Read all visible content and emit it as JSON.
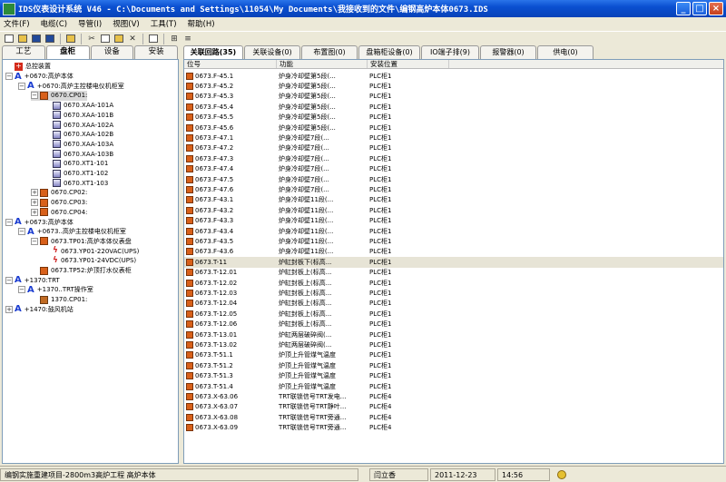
{
  "window": {
    "title": "IDS仪表设计系统 V46 - C:\\Documents and Settings\\11054\\My Documents\\我接收到的文件\\编钢高炉本体0673.IDS",
    "buttons": [
      "_",
      "□",
      "×"
    ]
  },
  "menu": [
    "文件(F)",
    "电缆(C)",
    "导管(I)",
    "视图(V)",
    "工具(T)",
    "帮助(H)"
  ],
  "left_tabs": [
    {
      "label": "工艺",
      "active": false
    },
    {
      "label": "盘柜",
      "active": true
    },
    {
      "label": "设备",
      "active": false
    },
    {
      "label": "安装",
      "active": false
    }
  ],
  "tree": [
    {
      "level": 0,
      "icon": "root",
      "expander": "",
      "label": "总控装置",
      "selected": false
    },
    {
      "level": 0,
      "icon": "area",
      "expander": "−",
      "label": "+0670:高炉本体",
      "selected": false
    },
    {
      "level": 1,
      "icon": "area",
      "expander": "−",
      "label": "+0670:高炉主控楼电仪机柜室",
      "selected": false
    },
    {
      "level": 2,
      "icon": "cab",
      "expander": "−",
      "label": "0670.CP01:",
      "selected": true
    },
    {
      "level": 3,
      "icon": "inst",
      "expander": "",
      "label": "0670.XAA-101A",
      "selected": false
    },
    {
      "level": 3,
      "icon": "inst",
      "expander": "",
      "label": "0670.XAA-101B",
      "selected": false
    },
    {
      "level": 3,
      "icon": "inst",
      "expander": "",
      "label": "0670.XAA-102A",
      "selected": false
    },
    {
      "level": 3,
      "icon": "inst",
      "expander": "",
      "label": "0670.XAA-102B",
      "selected": false
    },
    {
      "level": 3,
      "icon": "inst",
      "expander": "",
      "label": "0670.XAA-103A",
      "selected": false
    },
    {
      "level": 3,
      "icon": "inst",
      "expander": "",
      "label": "0670.XAA-103B",
      "selected": false
    },
    {
      "level": 3,
      "icon": "inst",
      "expander": "",
      "label": "0670.XT1-101",
      "selected": false
    },
    {
      "level": 3,
      "icon": "inst",
      "expander": "",
      "label": "0670.XT1-102",
      "selected": false
    },
    {
      "level": 3,
      "icon": "inst",
      "expander": "",
      "label": "0670.XT1-103",
      "selected": false
    },
    {
      "level": 2,
      "icon": "cab",
      "expander": "+",
      "label": "0670.CP02:",
      "selected": false
    },
    {
      "level": 2,
      "icon": "cab",
      "expander": "+",
      "label": "0670.CP03:",
      "selected": false
    },
    {
      "level": 2,
      "icon": "cab",
      "expander": "+",
      "label": "0670.CP04:",
      "selected": false
    },
    {
      "level": 0,
      "icon": "area",
      "expander": "−",
      "label": "+0673:高炉本体",
      "selected": false
    },
    {
      "level": 1,
      "icon": "area",
      "expander": "−",
      "label": "+0673..高炉主控楼电仪机柜室",
      "selected": false
    },
    {
      "level": 2,
      "icon": "cab",
      "expander": "−",
      "label": "0673.TP01:高炉本体仪表盘",
      "selected": false
    },
    {
      "level": 3,
      "icon": "pwr",
      "expander": "",
      "label": "0673.YP01-220VAC(UPS)",
      "selected": false
    },
    {
      "level": 3,
      "icon": "pwr",
      "expander": "",
      "label": "0673.YP01-24VDC(UPS)",
      "selected": false
    },
    {
      "level": 2,
      "icon": "cab",
      "expander": "",
      "label": "0673.TP52:炉顶打水仪表柜",
      "selected": false
    },
    {
      "level": 0,
      "icon": "area",
      "expander": "−",
      "label": "+1370:TRT",
      "selected": false
    },
    {
      "level": 1,
      "icon": "area",
      "expander": "−",
      "label": "+1370..TRT操作室",
      "selected": false
    },
    {
      "level": 2,
      "icon": "room",
      "expander": "",
      "label": "1370.CP01:",
      "selected": false
    },
    {
      "level": 0,
      "icon": "area",
      "expander": "+",
      "label": "+1470:鼓风机站",
      "selected": false
    }
  ],
  "right_tabs": [
    {
      "label": "关联回路(35)",
      "active": true
    },
    {
      "label": "关联设备(0)",
      "active": false
    },
    {
      "label": "布置图(0)",
      "active": false
    },
    {
      "label": "盘箱柜设备(0)",
      "active": false
    },
    {
      "label": "IO端子排(9)",
      "active": false
    },
    {
      "label": "报警器(0)",
      "active": false
    },
    {
      "label": "供电(0)",
      "active": false
    }
  ],
  "grid_columns": [
    "位号",
    "功能",
    "安装位置"
  ],
  "grid_rows": [
    {
      "tag": "0673.F-45.1",
      "func": "炉身冷却壁第5段(...",
      "loc": "PLC柜1",
      "sel": false
    },
    {
      "tag": "0673.F-45.2",
      "func": "炉身冷却壁第5段(...",
      "loc": "PLC柜1",
      "sel": false
    },
    {
      "tag": "0673.F-45.3",
      "func": "炉身冷却壁第5段(...",
      "loc": "PLC柜1",
      "sel": false
    },
    {
      "tag": "0673.F-45.4",
      "func": "炉身冷却壁第5段(...",
      "loc": "PLC柜1",
      "sel": false
    },
    {
      "tag": "0673.F-45.5",
      "func": "炉身冷却壁第5段(...",
      "loc": "PLC柜1",
      "sel": false
    },
    {
      "tag": "0673.F-45.6",
      "func": "炉身冷却壁第5段(...",
      "loc": "PLC柜1",
      "sel": false
    },
    {
      "tag": "0673.F-47.1",
      "func": "炉身冷却壁7段(...",
      "loc": "PLC柜1",
      "sel": false
    },
    {
      "tag": "0673.F-47.2",
      "func": "炉身冷却壁7段(...",
      "loc": "PLC柜1",
      "sel": false
    },
    {
      "tag": "0673.F-47.3",
      "func": "炉身冷却壁7段(...",
      "loc": "PLC柜1",
      "sel": false
    },
    {
      "tag": "0673.F-47.4",
      "func": "炉身冷却壁7段(...",
      "loc": "PLC柜1",
      "sel": false
    },
    {
      "tag": "0673.F-47.5",
      "func": "炉身冷却壁7段(...",
      "loc": "PLC柜1",
      "sel": false
    },
    {
      "tag": "0673.F-47.6",
      "func": "炉身冷却壁7段(...",
      "loc": "PLC柜1",
      "sel": false
    },
    {
      "tag": "0673.F-43.1",
      "func": "炉身冷却壁11段(...",
      "loc": "PLC柜1",
      "sel": false
    },
    {
      "tag": "0673.F-43.2",
      "func": "炉身冷却壁11段(...",
      "loc": "PLC柜1",
      "sel": false
    },
    {
      "tag": "0673.F-43.3",
      "func": "炉身冷却壁11段(...",
      "loc": "PLC柜1",
      "sel": false
    },
    {
      "tag": "0673.F-43.4",
      "func": "炉身冷却壁11段(...",
      "loc": "PLC柜1",
      "sel": false
    },
    {
      "tag": "0673.F-43.5",
      "func": "炉身冷却壁11段(...",
      "loc": "PLC柜1",
      "sel": false
    },
    {
      "tag": "0673.F-43.6",
      "func": "炉身冷却壁11段(...",
      "loc": "PLC柜1",
      "sel": false
    },
    {
      "tag": "0673.T-11",
      "func": "炉缸封板下(标高...",
      "loc": "PLC柜1",
      "sel": true
    },
    {
      "tag": "0673.T-12.01",
      "func": "炉缸封板上(标高...",
      "loc": "PLC柜1",
      "sel": false
    },
    {
      "tag": "0673.T-12.02",
      "func": "炉缸封板上(标高...",
      "loc": "PLC柜1",
      "sel": false
    },
    {
      "tag": "0673.T-12.03",
      "func": "炉缸封板上(标高...",
      "loc": "PLC柜1",
      "sel": false
    },
    {
      "tag": "0673.T-12.04",
      "func": "炉缸封板上(标高...",
      "loc": "PLC柜1",
      "sel": false
    },
    {
      "tag": "0673.T-12.05",
      "func": "炉缸封板上(标高...",
      "loc": "PLC柜1",
      "sel": false
    },
    {
      "tag": "0673.T-12.06",
      "func": "炉缸封板上(标高...",
      "loc": "PLC柜1",
      "sel": false
    },
    {
      "tag": "0673.T-13.01",
      "func": "炉缸两层破碎阀(...",
      "loc": "PLC柜1",
      "sel": false
    },
    {
      "tag": "0673.T-13.02",
      "func": "炉缸两层破碎阀(...",
      "loc": "PLC柜1",
      "sel": false
    },
    {
      "tag": "0673.T-51.1",
      "func": "炉顶上升管煤气温度",
      "loc": "PLC柜1",
      "sel": false
    },
    {
      "tag": "0673.T-51.2",
      "func": "炉顶上升管煤气温度",
      "loc": "PLC柜1",
      "sel": false
    },
    {
      "tag": "0673.T-51.3",
      "func": "炉顶上升管煤气温度",
      "loc": "PLC柜1",
      "sel": false
    },
    {
      "tag": "0673.T-51.4",
      "func": "炉顶上升管煤气温度",
      "loc": "PLC柜1",
      "sel": false
    },
    {
      "tag": "0673.X-63.06",
      "func": "TRT联锁信号TRT发电...",
      "loc": "PLC柜4",
      "sel": false
    },
    {
      "tag": "0673.X-63.07",
      "func": "TRT联锁信号TRT静叶...",
      "loc": "PLC柜4",
      "sel": false
    },
    {
      "tag": "0673.X-63.08",
      "func": "TRT联锁信号TRT旁通...",
      "loc": "PLC柜4",
      "sel": false
    },
    {
      "tag": "0673.X-63.09",
      "func": "TRT联锁信号TRT旁通...",
      "loc": "PLC柜4",
      "sel": false
    }
  ],
  "status": {
    "project": "编钢实施重建项目-2800m3高炉工程 高炉本体",
    "user": "闫立香",
    "date": "2011-12-23",
    "time": "14:56"
  }
}
